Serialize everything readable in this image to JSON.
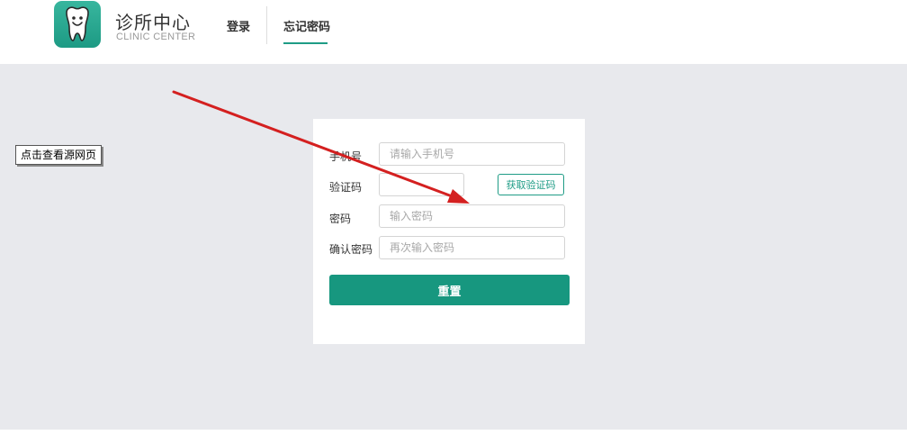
{
  "header": {
    "brand_title": "诊所中心",
    "brand_subtitle": "CLINIC CENTER",
    "nav": {
      "login": "登录",
      "forgot_password": "忘记密码"
    },
    "active_tab": "forgot_password",
    "accent_color": "#1f9c86"
  },
  "overlay": {
    "view_source_label": "点击查看源网页"
  },
  "form": {
    "phone": {
      "label": "手机号",
      "placeholder": "请输入手机号",
      "value": ""
    },
    "code": {
      "label": "验证码",
      "placeholder": "",
      "value": "",
      "button_label": "获取验证码"
    },
    "password": {
      "label": "密码",
      "placeholder": "输入密码",
      "value": ""
    },
    "confirm_password": {
      "label": "确认密码",
      "placeholder": "再次输入密码",
      "value": ""
    },
    "submit_label": "重置",
    "submit_color": "#17977f"
  },
  "annotation": {
    "arrow_color": "#d42020"
  },
  "icons": {
    "logo": "tooth-icon"
  }
}
